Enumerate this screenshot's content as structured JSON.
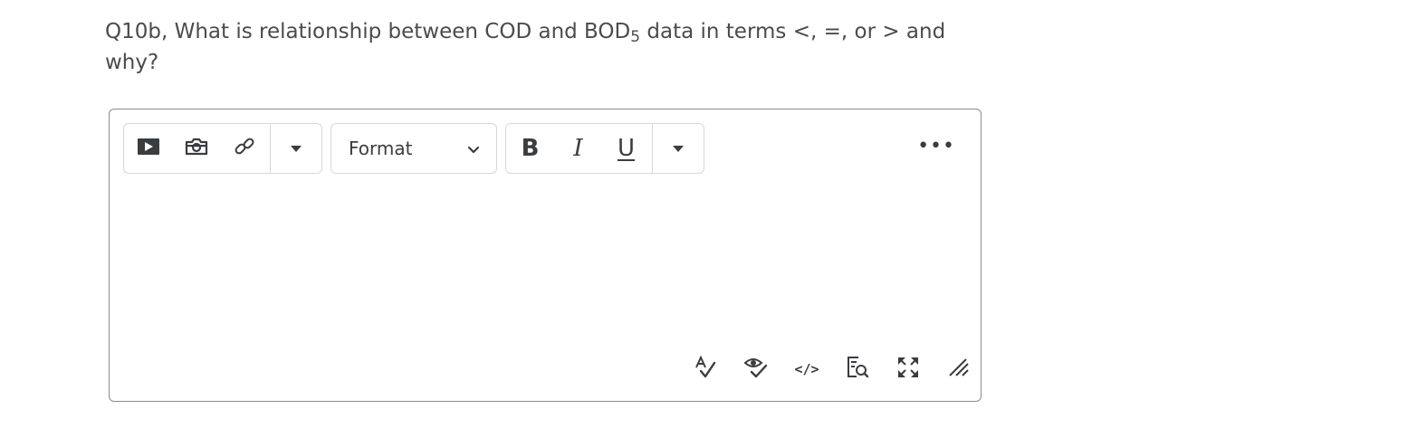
{
  "question": {
    "text_before_sub": "Q10b, What is relationship between COD and BOD",
    "subscript": "5",
    "text_after_sub": " data in terms <, =, or > and why?"
  },
  "editor": {
    "toolbar": {
      "insert_group": {
        "items": [
          {
            "icon": "play-icon",
            "label": "Insert Stuff"
          },
          {
            "icon": "camera-icon",
            "label": "Insert Image"
          },
          {
            "icon": "link-icon",
            "label": "Insert Quicklink"
          }
        ],
        "more_icon": "caret-down-icon"
      },
      "format": {
        "selected": "Format",
        "icon": "chevron-down-icon"
      },
      "text_style_group": {
        "bold_label": "B",
        "italic_label": "I",
        "underline_label": "U",
        "more_icon": "caret-down-icon"
      },
      "overflow_label": "•••"
    },
    "content": "",
    "bottom_toolbar": [
      {
        "icon": "spellcheck-icon"
      },
      {
        "icon": "accessibility-check-icon"
      },
      {
        "icon": "source-code-icon",
        "label": "</>"
      },
      {
        "icon": "preview-icon"
      },
      {
        "icon": "fullscreen-icon"
      },
      {
        "icon": "resize-handle-icon"
      }
    ]
  }
}
